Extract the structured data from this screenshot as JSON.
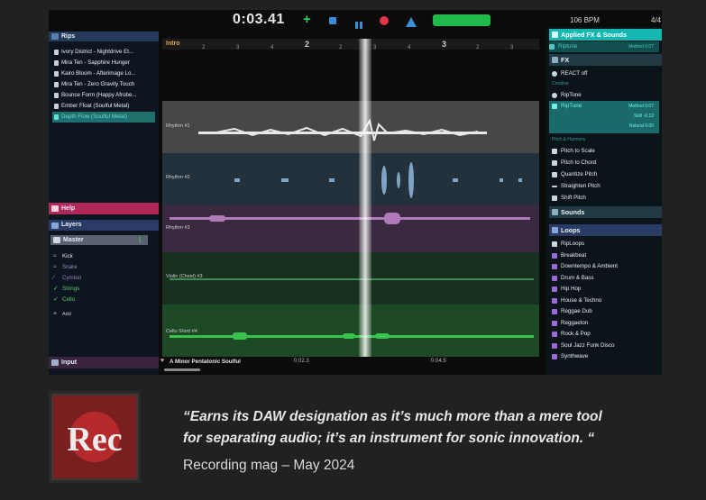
{
  "transport": {
    "timecode": "0:03.41",
    "bpm": "106 BPM",
    "time_signature": "4/4"
  },
  "rips": {
    "title": "Rips",
    "items": [
      "Ivory District - Nightdrive Et...",
      "Mira Ten - Sapphire Hunger",
      "Kairo Bloom - Afterimage Lo...",
      "Mira Ten - Zero Gravity Touch",
      "Bounce Form (Happy Afrobe...",
      "Ember Float (Soulful Metal)",
      "Depth Flow (Soulful Metal)"
    ]
  },
  "help": {
    "title": "Help"
  },
  "layers": {
    "title": "Layers",
    "master": "Master",
    "items": [
      "Kick",
      "Snare",
      "Cymbal",
      "Strings",
      "Cello"
    ],
    "add": "Add"
  },
  "input": {
    "title": "Input"
  },
  "timeline": {
    "section": "Intro",
    "ticks": [
      "2",
      "3",
      "4",
      "2",
      "3",
      "4",
      "2",
      "3",
      "4"
    ],
    "bars": [
      "2",
      "3"
    ],
    "tracks": [
      {
        "name": "Rhythm #1",
        "color": "#e8e8e8"
      },
      {
        "name": "Rhythm #2",
        "color": "#7fa3c4"
      },
      {
        "name": "Rhythm #3",
        "color": "#b07ab8"
      },
      {
        "name": "Violin (Chest) #3",
        "color": "#3f8a55"
      },
      {
        "name": "Cello Short #4",
        "color": "#39c24e"
      }
    ]
  },
  "status": {
    "key": "A Minor Pentatonic Soulful",
    "t1": "0:02.3",
    "t2": "0:04.5"
  },
  "fx_panel": {
    "applied": "Applied FX & Sounds",
    "applied_item": "Riptune",
    "applied_value": "Method 0.07",
    "fx": "FX",
    "react": "REACT off",
    "creative": "Creative",
    "riptone": "RipTone",
    "riptune": "RipTune",
    "riptune_value1": "Method 0.07",
    "riptune_value2": "Skill -0.12",
    "riptune_value3": "Natural 0.00",
    "pitch_harmony": "Pitch & Harmony",
    "pitch_items": [
      "Pitch to Scale",
      "Pitch to Chord",
      "Quantize Pitch",
      "Straighten Pitch",
      "Shift Pitch"
    ],
    "sounds": "Sounds",
    "loops": "Loops",
    "loop_items": [
      "RipLoops",
      "Breakbeat",
      "Downtempo & Ambient",
      "Drum & Bass",
      "Hip Hop",
      "House & Techno",
      "Reggae Dub",
      "Reggaeton",
      "Rock & Pop",
      "Soul Jazz Funk Disco",
      "Synthwave"
    ]
  },
  "review": {
    "logo_text": "Rec",
    "quote": "“Earns its DAW designation as it’s much more than a mere tool for separating audio; it’s an instrument for sonic innovation. “",
    "source": "Recording mag – May 2024"
  },
  "colors": {
    "accent_teal": "#15b8b0",
    "help_pink": "#b0285a",
    "layers_blue": "#2a3c66"
  }
}
